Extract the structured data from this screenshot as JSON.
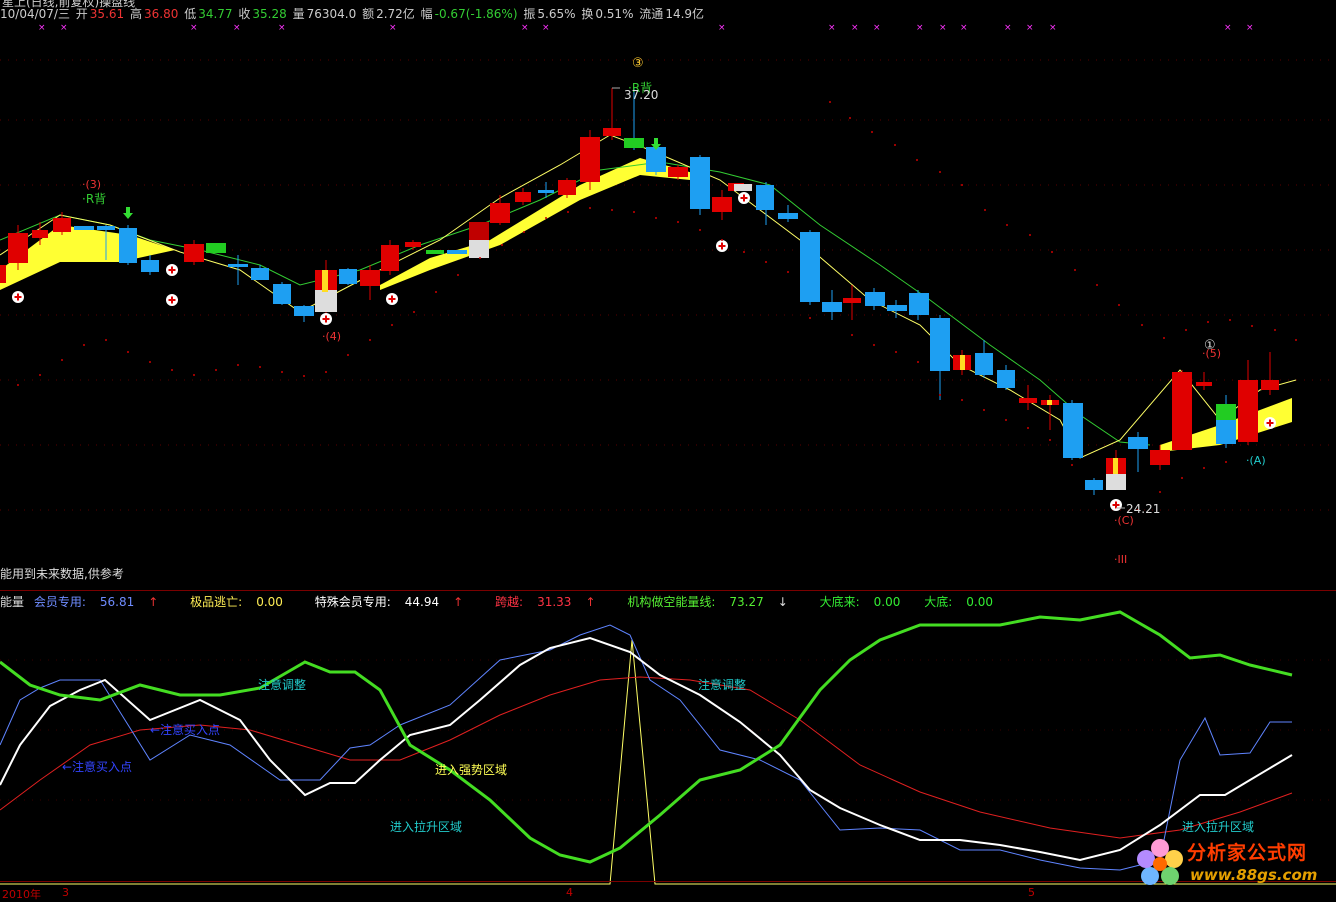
{
  "header": {
    "title_fragment": "星上(日线,前复权)操盘线",
    "date": "10/04/07/三",
    "open_label": "开",
    "open": "35.61",
    "high_label": "高",
    "high": "36.80",
    "low_label": "低",
    "low": "34.77",
    "close_label": "收",
    "close": "35.28",
    "vol_label": "量",
    "vol": "76304.0",
    "amt_label": "额",
    "amt": "2.72亿",
    "chg_label": "幅",
    "chg": "-0.67(-1.86%)",
    "amp_label": "振",
    "amp": "5.65%",
    "turn_label": "换",
    "turn": "0.51%",
    "float_label": "流通",
    "float": "14.9亿"
  },
  "main_chart": {
    "notice": "能用到未来数据,供参考",
    "labels": {
      "peak_circle": "③",
      "peak_r": "·R背",
      "peak_price": "37.20",
      "left_num": "·(3)",
      "left_r": "·R背",
      "wave4": "·(4)",
      "low_price": "24.21",
      "wave_c": "·(C)",
      "wave_iii": "·III",
      "right_circle": "①",
      "right_5": "·(5)",
      "wave_a": "·(A)"
    }
  },
  "indicator": {
    "name": "能量",
    "member_label": "会员专用:",
    "member": "56.81",
    "escape_label": "极品逃亡:",
    "escape": "0.00",
    "special_label": "特殊会员专用:",
    "special": "44.94",
    "leap_label": "跨越:",
    "leap": "31.33",
    "inst_label": "机构做空能量线:",
    "inst": "73.27",
    "bottom_label": "大底来:",
    "bottom": "0.00",
    "bottom2_label": "大底:",
    "bottom2": "0.00",
    "annotations": {
      "adjust1": "注意调整",
      "adjust2": "注意调整",
      "buy1": "←注意买入点",
      "buy2": "←注意买入点",
      "strong": "进入强势区域",
      "pull1": "进入拉升区域",
      "pull2": "进入拉升区域"
    }
  },
  "axis": {
    "year": "2010年",
    "m3": "3",
    "m4": "4",
    "m5": "5"
  },
  "watermark": {
    "title": "分析家公式网",
    "url": "www.88gs.com"
  },
  "colors": {
    "up": "#e00000",
    "down": "#1e9ff2",
    "ribbon": "#ffff33",
    "ma": "#33cc33",
    "white_line": "#ffffff",
    "blue_line": "#5f84ff",
    "red_line": "#e02020",
    "green_line": "#44dd22"
  }
}
